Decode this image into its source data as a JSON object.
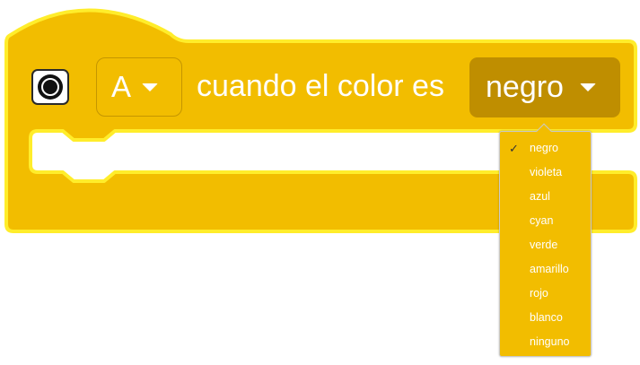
{
  "block": {
    "port_label": "A",
    "text": "cuando el color es",
    "selected_color": "negro",
    "block_color": "#f2bd00",
    "outline_color": "#ffed2b",
    "dropdown_color": "#bf8e00"
  },
  "color_menu": {
    "items": [
      {
        "label": "negro",
        "checked": true
      },
      {
        "label": "violeta",
        "checked": false
      },
      {
        "label": "azul",
        "checked": false
      },
      {
        "label": "cyan",
        "checked": false
      },
      {
        "label": "verde",
        "checked": false
      },
      {
        "label": "amarillo",
        "checked": false
      },
      {
        "label": "rojo",
        "checked": false
      },
      {
        "label": "blanco",
        "checked": false
      },
      {
        "label": "ninguno",
        "checked": false
      }
    ],
    "check_mark": "✓"
  }
}
